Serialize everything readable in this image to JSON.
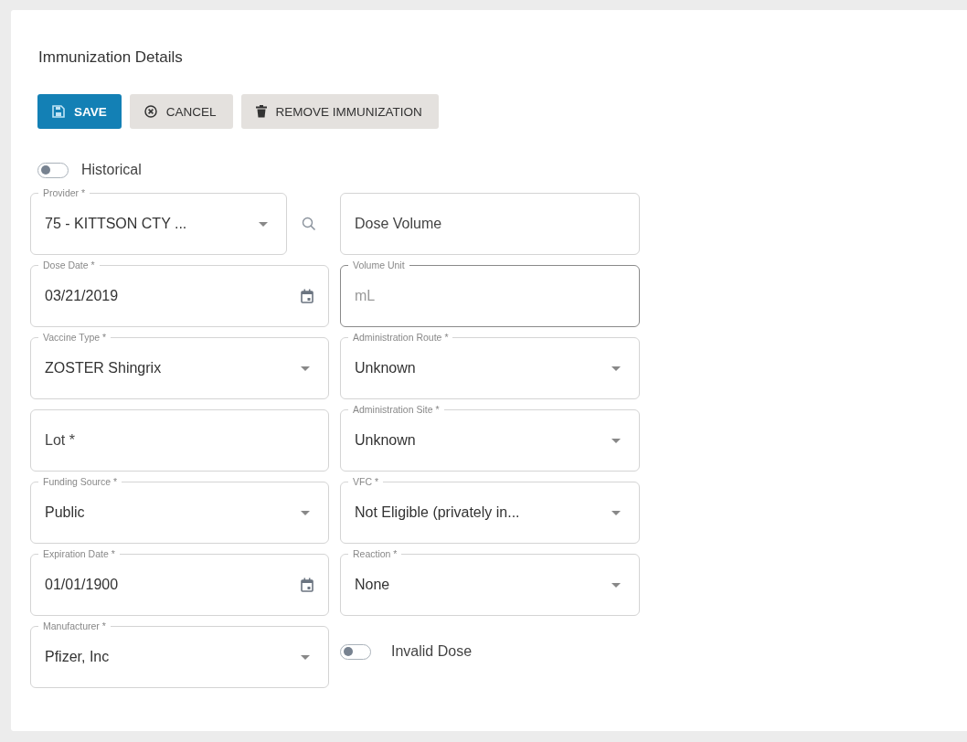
{
  "title": "Immunization Details",
  "buttons": [
    {
      "kind": "save",
      "label": "SAVE"
    },
    {
      "kind": "cancel",
      "label": "CANCEL"
    },
    {
      "kind": "remove",
      "label": "REMOVE IMMUNIZATION"
    }
  ],
  "historical": {
    "label": "Historical",
    "on": false
  },
  "fields": [
    {
      "kind": "select-search",
      "label": "Provider *",
      "value": "75 - KITTSON CTY ...",
      "disabled": false
    },
    {
      "kind": "text",
      "placeholder": "Dose Volume",
      "disabled": false
    },
    {
      "kind": "date",
      "label": "Dose Date *",
      "value": "03/21/2019",
      "disabled": false
    },
    {
      "kind": "text",
      "label": "Volume Unit",
      "value": "mL",
      "disabled": true
    },
    {
      "kind": "select",
      "label": "Vaccine Type *",
      "value": "ZOSTER Shingrix",
      "disabled": false
    },
    {
      "kind": "select",
      "label": "Administration Route *",
      "value": "Unknown",
      "disabled": false
    },
    {
      "kind": "text",
      "placeholder": "Lot *",
      "disabled": false
    },
    {
      "kind": "select",
      "label": "Administration Site *",
      "value": "Unknown",
      "disabled": false
    },
    {
      "kind": "select",
      "label": "Funding Source *",
      "value": "Public",
      "disabled": false
    },
    {
      "kind": "select",
      "label": "VFC *",
      "value": "Not Eligible (privately in...",
      "disabled": false
    },
    {
      "kind": "date",
      "label": "Expiration Date *",
      "value": "01/01/1900",
      "disabled": false
    },
    {
      "kind": "select",
      "label": "Reaction *",
      "value": "None",
      "disabled": false
    },
    {
      "kind": "select",
      "label": "Manufacturer *",
      "value": "Pfizer, Inc",
      "disabled": false
    },
    {
      "kind": "toggle",
      "label": "Invalid Dose",
      "on": false
    }
  ]
}
